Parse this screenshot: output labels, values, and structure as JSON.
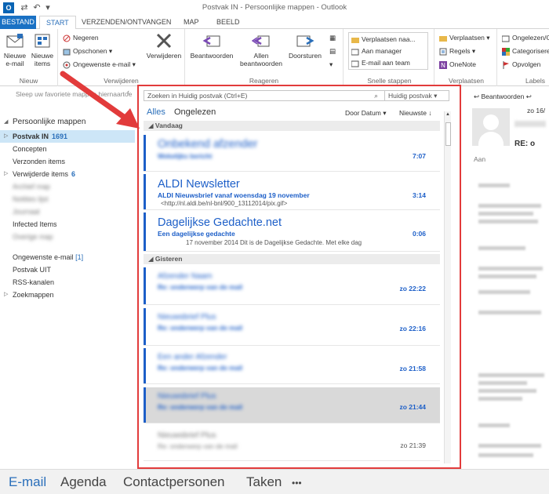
{
  "window": {
    "title": "Postvak IN - Persoonlijke mappen - Outlook"
  },
  "tabs": {
    "file": "BESTAND",
    "start": "START",
    "send": "VERZENDEN/ONTVANGEN",
    "folder": "MAP",
    "view": "BEELD"
  },
  "ribbon": {
    "nieuw": {
      "label": "Nieuw",
      "email": "Nieuwe e-mail",
      "items": "Nieuwe items"
    },
    "verwijderen": {
      "label": "Verwijderen",
      "ignore": "Negeren",
      "cleanup": "Opschonen",
      "junk": "Ongewenste e-mail",
      "delete": "Verwijderen"
    },
    "reageren": {
      "label": "Reageren",
      "reply": "Beantwoorden",
      "replyall": "Allen beantwoorden",
      "forward": "Doorsturen"
    },
    "snelle": {
      "label": "Snelle stappen",
      "move": "Verplaatsen naa...",
      "manager": "Aan manager",
      "team": "E-mail aan team"
    },
    "verplaatsen": {
      "label": "Verplaatsen",
      "move": "Verplaatsen",
      "rules": "Regels",
      "onenote": "OneNote"
    },
    "labels": {
      "label": "Labels",
      "unread": "Ongelezen/Gele...",
      "categorize": "Categoriseren",
      "followup": "Opvolgen"
    }
  },
  "nav": {
    "hint": "Sleep uw favoriete mappen hiernaartoe",
    "root": "Persoonlijke mappen",
    "inbox": "Postvak IN",
    "inbox_count": "1691",
    "concepts": "Concepten",
    "sent": "Verzonden items",
    "deleted": "Verwijderde items",
    "deleted_count": "6",
    "blur1": "Archief map",
    "blur2": "Notities lijst",
    "blur3": "Journaal",
    "infected": "Infected Items",
    "blur4": "Overige map",
    "junk": "Ongewenste e-mail",
    "junk_count": "[1]",
    "outbox": "Postvak UIT",
    "rss": "RSS-kanalen",
    "search": "Zoekmappen"
  },
  "list": {
    "search_placeholder": "Zoeken in Huidig postvak (Ctrl+E)",
    "search_scope": "Huidig postvak",
    "filter_all": "Alles",
    "filter_unread": "Ongelezen",
    "sort_by": "Door Datum",
    "sort_order": "Nieuwste",
    "group_today": "Vandaag",
    "group_yesterday": "Gisteren",
    "mails": [
      {
        "from": "Onbekend afzender",
        "subject": "Wekelijks bericht",
        "preview": "",
        "time": "7:07"
      },
      {
        "from": "ALDI Newsletter",
        "subject": "ALDI Nieuwsbrief vanaf woensdag 19 november",
        "preview": "<http://nl.aldi.be/nl-bnl/900_13112014/pix.gif>",
        "time": "3:14"
      },
      {
        "from": "Dagelijkse Gedachte.net",
        "subject": "Een dagelijkse gedachte",
        "preview": "17 november 2014  Dit is de Dagelijkse Gedachte. Met elke dag",
        "time": "0:06"
      },
      {
        "from": "Afzender Naam",
        "subject": "Re: onderwerp van de mail",
        "preview": "",
        "time": "zo 22:22"
      },
      {
        "from": "Nieuwsbrief Plus",
        "subject": "Re: onderwerp van de mail",
        "preview": "",
        "time": "zo 22:16"
      },
      {
        "from": "Een ander Afzender",
        "subject": "Re: onderwerp van de mail",
        "preview": "",
        "time": "zo 21:58"
      },
      {
        "from": "Nieuwsbrief Plus",
        "subject": "Re: onderwerp van de mail",
        "preview": "",
        "time": "zo 21:44"
      },
      {
        "from": "Nieuwsbrief Plus",
        "subject": "Re: onderwerp van de mail",
        "preview": "",
        "time": "zo 21:39"
      }
    ]
  },
  "reading": {
    "reply": "Beantwoorden",
    "date": "zo 16/",
    "re": "RE: o",
    "to": "Aan"
  },
  "bottom": {
    "mail": "E-mail",
    "calendar": "Agenda",
    "contacts": "Contactpersonen",
    "tasks": "Taken",
    "more": "•••"
  },
  "colors": {
    "accent": "#2a6fba",
    "unread": "#1d5fc8",
    "highlight": "#e23b3b"
  }
}
